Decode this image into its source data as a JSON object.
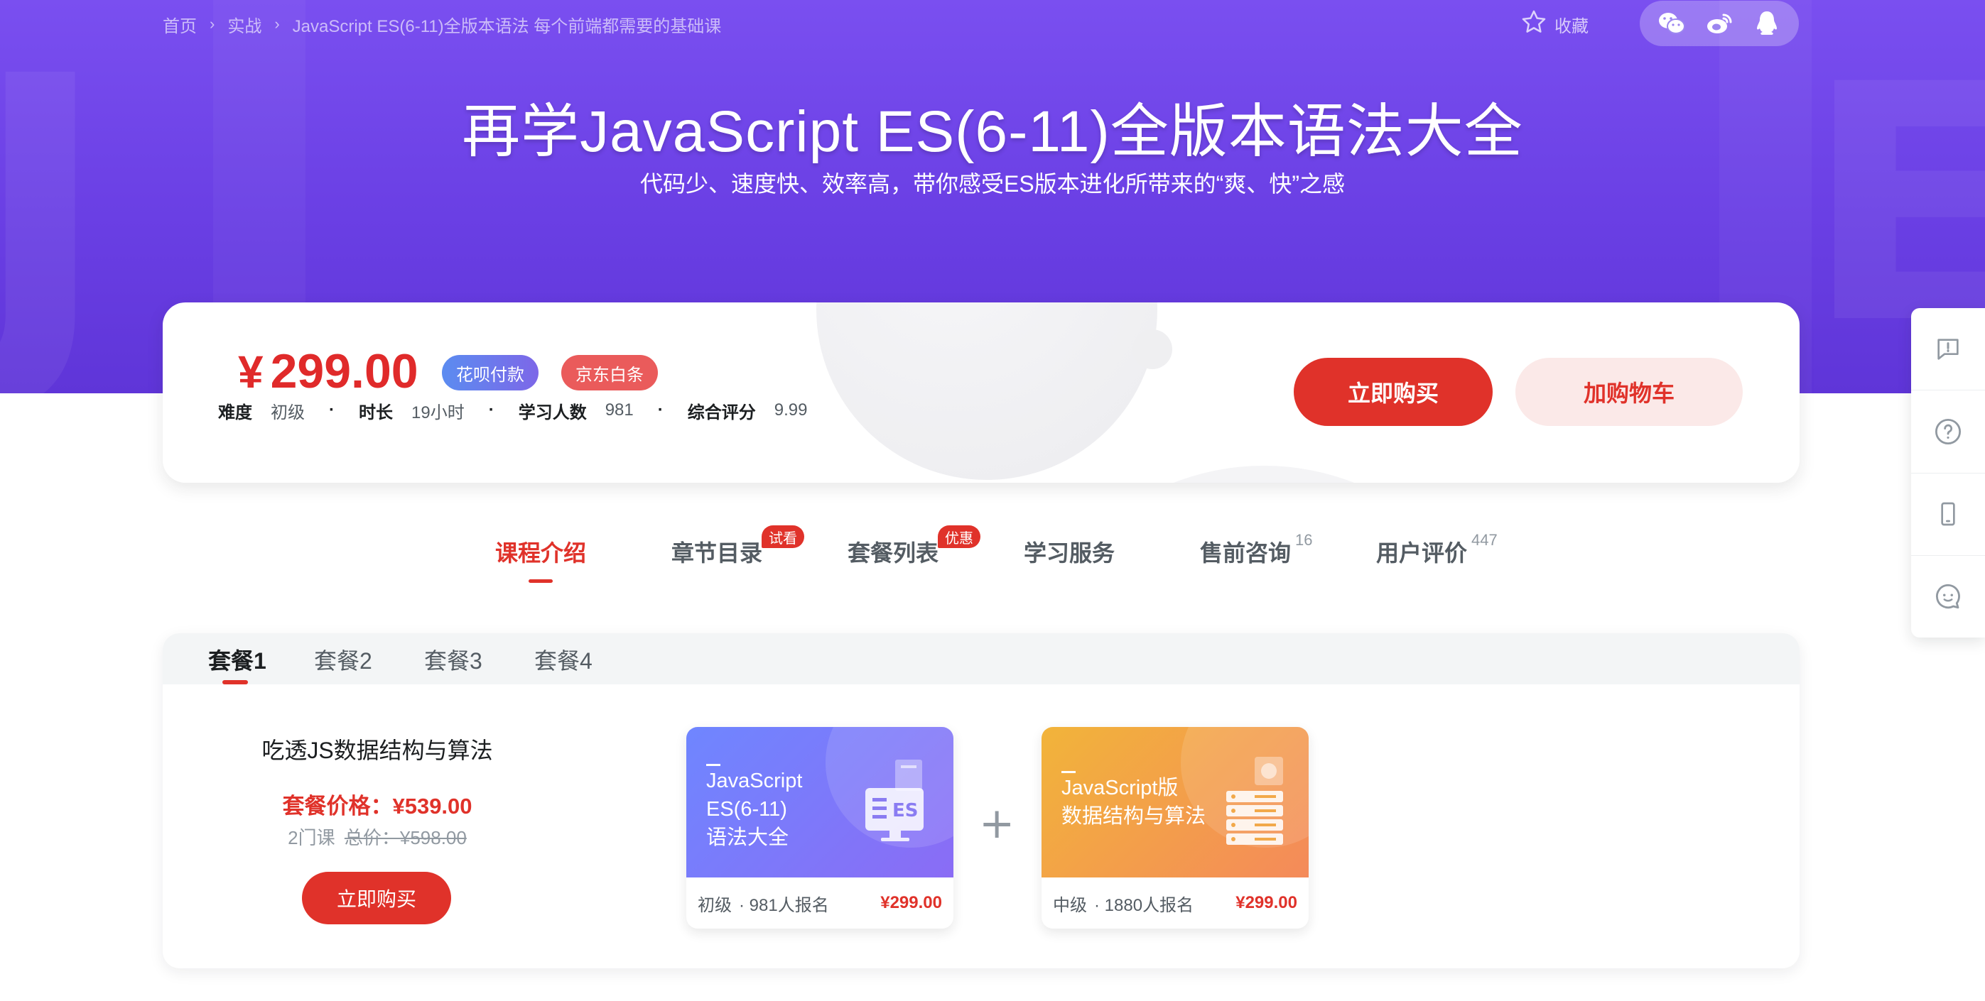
{
  "breadcrumb": [
    "首页",
    "实战",
    "JavaScript ES(6-11)全版本语法 每个前端都需要的基础课"
  ],
  "favorite_label": "收藏",
  "share_icons": [
    "wechat-icon",
    "weibo-icon",
    "qq-icon"
  ],
  "hero": {
    "title": "再学JavaScript ES(6-11)全版本语法大全",
    "subtitle": "代码少、速度快、效率高，带你感受ES版本进化所带来的“爽、快”之感"
  },
  "price_card": {
    "currency": "¥",
    "price": "299.00",
    "tags": [
      "花呗付款",
      "京东白条"
    ],
    "meta": [
      {
        "label": "难度",
        "value": "初级"
      },
      {
        "label": "时长",
        "value": "19小时"
      },
      {
        "label": "学习人数",
        "value": "981"
      },
      {
        "label": "综合评分",
        "value": "9.99"
      }
    ],
    "buy_label": "立即购买",
    "cart_label": "加购物车"
  },
  "nav_tabs": [
    {
      "label": "课程介绍",
      "active": true
    },
    {
      "label": "章节目录",
      "badge": "试看"
    },
    {
      "label": "套餐列表",
      "badge": "优惠"
    },
    {
      "label": "学习服务"
    },
    {
      "label": "售前咨询",
      "count": "16"
    },
    {
      "label": "用户评价",
      "count": "447"
    }
  ],
  "packages": {
    "tabs": [
      "套餐1",
      "套餐2",
      "套餐3",
      "套餐4"
    ],
    "active_tab": "套餐1",
    "name": "吃透JS数据结构与算法",
    "price_text": "套餐价格：¥539.00",
    "course_count": "2门课",
    "total_price": "总价：¥598.00",
    "buy_label": "立即购买",
    "courses": [
      {
        "title": "JavaScript\nES(6-11)\n语法大全",
        "level": "初级",
        "enrolled": "981人报名",
        "price": "¥299.00",
        "color_from": "#6f86ff",
        "color_to": "#8a6cf5",
        "icon": "es-monitor-icon"
      },
      {
        "title": "JavaScript版\n数据结构与算法",
        "level": "中级",
        "enrolled": "1880人报名",
        "price": "¥299.00",
        "color_from": "#f2b43a",
        "color_to": "#f48a5a",
        "icon": "server-stack-icon"
      }
    ]
  },
  "side_tools": [
    "feedback-icon",
    "help-icon",
    "mobile-icon",
    "chat-icon"
  ],
  "colors": {
    "accent": "#e0322a",
    "hero": "#6a3fe4",
    "text": "#1c1f21",
    "muted": "#9199a1"
  }
}
